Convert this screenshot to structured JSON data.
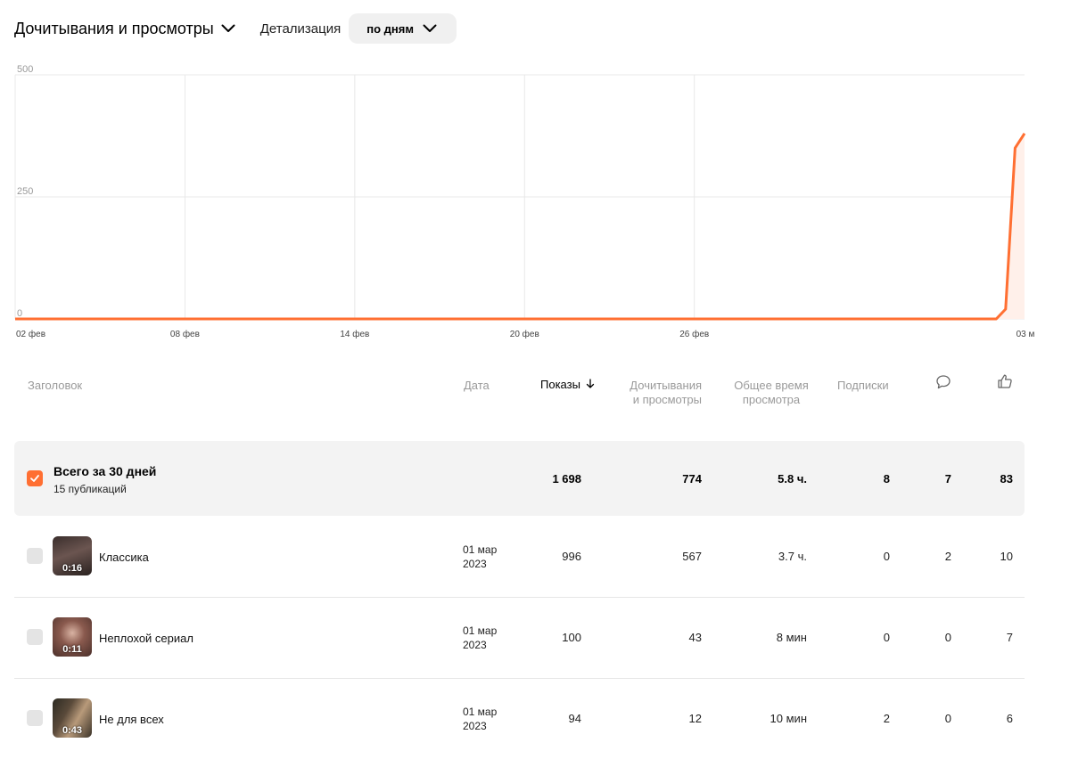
{
  "header": {
    "metric_label": "Дочитывания и просмотры",
    "detail_label": "Детализация",
    "period_label": "по дням"
  },
  "chart_data": {
    "type": "area",
    "y_ticks": [
      "500",
      "250",
      "0"
    ],
    "x_tick_labels": [
      "02 фев",
      "08 фев",
      "14 фев",
      "20 фев",
      "26 фев",
      "03 м"
    ],
    "ylim": [
      0,
      500
    ],
    "grid": true,
    "series": [
      {
        "color": "#ff6f32",
        "fill": "#fff0ea",
        "values": [
          0,
          0,
          0,
          0,
          0,
          0,
          0,
          0,
          0,
          0,
          0,
          0,
          0,
          0,
          0,
          0,
          0,
          0,
          0,
          0,
          0,
          0,
          0,
          0,
          0,
          0,
          0,
          0,
          0,
          0,
          0,
          0,
          0,
          0,
          0,
          0,
          0,
          0,
          0,
          0,
          0,
          0,
          0,
          0,
          0,
          0,
          0,
          0,
          0,
          0,
          0,
          0,
          0,
          0,
          0,
          0,
          0,
          0,
          0,
          0,
          0,
          0,
          0,
          0,
          0,
          0,
          0,
          0,
          0,
          0,
          0,
          0,
          0,
          0,
          0,
          0,
          0,
          0,
          0,
          0,
          0,
          0,
          0,
          0,
          0,
          0,
          0,
          0,
          0,
          0,
          0,
          0,
          0,
          0,
          0,
          0,
          0,
          0,
          0,
          0,
          0,
          0,
          0,
          0,
          0,
          20,
          350,
          380
        ]
      }
    ]
  },
  "table": {
    "columns": {
      "title": "Заголовок",
      "date": "Дата",
      "shows": "Показы",
      "reads_1": "Дочитывания",
      "reads_2": "и просмотры",
      "time_1": "Общее время",
      "time_2": "просмотра",
      "subs": "Подписки"
    },
    "total": {
      "title": "Всего за 30 дней",
      "subtitle": "15 публикаций",
      "shows": "1 698",
      "reads": "774",
      "time": "5.8 ч.",
      "subs": "8",
      "comments": "7",
      "likes": "83"
    },
    "rows": [
      {
        "title": "Классика",
        "duration": "0:16",
        "date_1": "01 мар",
        "date_2": "2023",
        "shows": "996",
        "reads": "567",
        "time": "3.7 ч.",
        "subs": "0",
        "comments": "2",
        "likes": "10"
      },
      {
        "title": "Неплохой сериал",
        "duration": "0:11",
        "date_1": "01 мар",
        "date_2": "2023",
        "shows": "100",
        "reads": "43",
        "time": "8 мин",
        "subs": "0",
        "comments": "0",
        "likes": "7"
      },
      {
        "title": "Не для всех",
        "duration": "0:43",
        "date_1": "01 мар",
        "date_2": "2023",
        "shows": "94",
        "reads": "12",
        "time": "10 мин",
        "subs": "2",
        "comments": "0",
        "likes": "6"
      }
    ]
  }
}
